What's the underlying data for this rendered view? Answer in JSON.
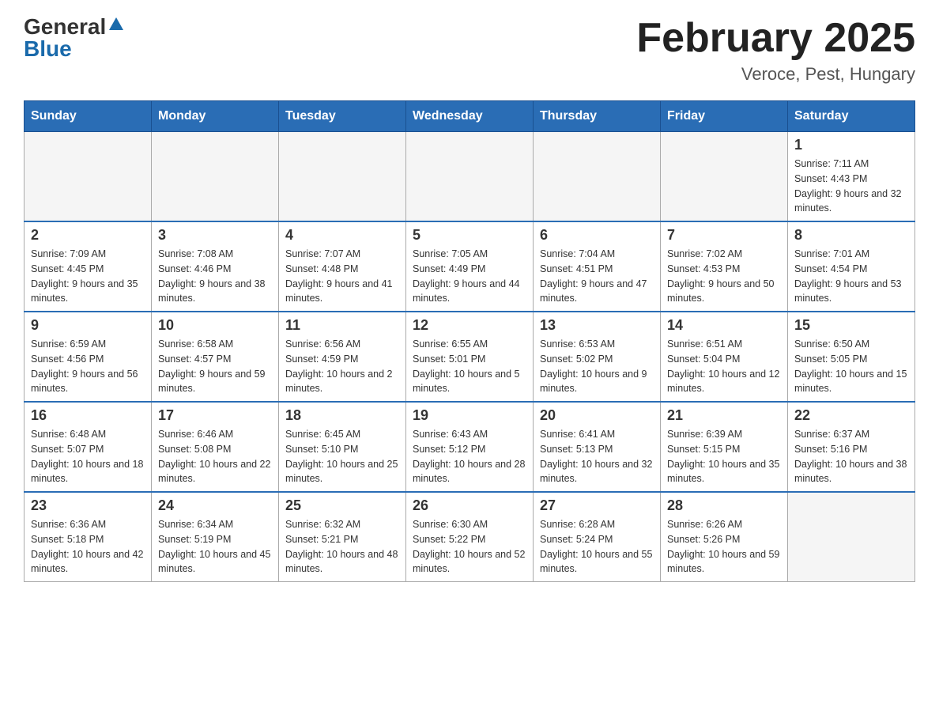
{
  "header": {
    "logo_general": "General",
    "logo_blue": "Blue",
    "month_title": "February 2025",
    "location": "Veroce, Pest, Hungary"
  },
  "days_of_week": [
    "Sunday",
    "Monday",
    "Tuesday",
    "Wednesday",
    "Thursday",
    "Friday",
    "Saturday"
  ],
  "weeks": [
    [
      {
        "day": "",
        "info": ""
      },
      {
        "day": "",
        "info": ""
      },
      {
        "day": "",
        "info": ""
      },
      {
        "day": "",
        "info": ""
      },
      {
        "day": "",
        "info": ""
      },
      {
        "day": "",
        "info": ""
      },
      {
        "day": "1",
        "info": "Sunrise: 7:11 AM\nSunset: 4:43 PM\nDaylight: 9 hours and 32 minutes."
      }
    ],
    [
      {
        "day": "2",
        "info": "Sunrise: 7:09 AM\nSunset: 4:45 PM\nDaylight: 9 hours and 35 minutes."
      },
      {
        "day": "3",
        "info": "Sunrise: 7:08 AM\nSunset: 4:46 PM\nDaylight: 9 hours and 38 minutes."
      },
      {
        "day": "4",
        "info": "Sunrise: 7:07 AM\nSunset: 4:48 PM\nDaylight: 9 hours and 41 minutes."
      },
      {
        "day": "5",
        "info": "Sunrise: 7:05 AM\nSunset: 4:49 PM\nDaylight: 9 hours and 44 minutes."
      },
      {
        "day": "6",
        "info": "Sunrise: 7:04 AM\nSunset: 4:51 PM\nDaylight: 9 hours and 47 minutes."
      },
      {
        "day": "7",
        "info": "Sunrise: 7:02 AM\nSunset: 4:53 PM\nDaylight: 9 hours and 50 minutes."
      },
      {
        "day": "8",
        "info": "Sunrise: 7:01 AM\nSunset: 4:54 PM\nDaylight: 9 hours and 53 minutes."
      }
    ],
    [
      {
        "day": "9",
        "info": "Sunrise: 6:59 AM\nSunset: 4:56 PM\nDaylight: 9 hours and 56 minutes."
      },
      {
        "day": "10",
        "info": "Sunrise: 6:58 AM\nSunset: 4:57 PM\nDaylight: 9 hours and 59 minutes."
      },
      {
        "day": "11",
        "info": "Sunrise: 6:56 AM\nSunset: 4:59 PM\nDaylight: 10 hours and 2 minutes."
      },
      {
        "day": "12",
        "info": "Sunrise: 6:55 AM\nSunset: 5:01 PM\nDaylight: 10 hours and 5 minutes."
      },
      {
        "day": "13",
        "info": "Sunrise: 6:53 AM\nSunset: 5:02 PM\nDaylight: 10 hours and 9 minutes."
      },
      {
        "day": "14",
        "info": "Sunrise: 6:51 AM\nSunset: 5:04 PM\nDaylight: 10 hours and 12 minutes."
      },
      {
        "day": "15",
        "info": "Sunrise: 6:50 AM\nSunset: 5:05 PM\nDaylight: 10 hours and 15 minutes."
      }
    ],
    [
      {
        "day": "16",
        "info": "Sunrise: 6:48 AM\nSunset: 5:07 PM\nDaylight: 10 hours and 18 minutes."
      },
      {
        "day": "17",
        "info": "Sunrise: 6:46 AM\nSunset: 5:08 PM\nDaylight: 10 hours and 22 minutes."
      },
      {
        "day": "18",
        "info": "Sunrise: 6:45 AM\nSunset: 5:10 PM\nDaylight: 10 hours and 25 minutes."
      },
      {
        "day": "19",
        "info": "Sunrise: 6:43 AM\nSunset: 5:12 PM\nDaylight: 10 hours and 28 minutes."
      },
      {
        "day": "20",
        "info": "Sunrise: 6:41 AM\nSunset: 5:13 PM\nDaylight: 10 hours and 32 minutes."
      },
      {
        "day": "21",
        "info": "Sunrise: 6:39 AM\nSunset: 5:15 PM\nDaylight: 10 hours and 35 minutes."
      },
      {
        "day": "22",
        "info": "Sunrise: 6:37 AM\nSunset: 5:16 PM\nDaylight: 10 hours and 38 minutes."
      }
    ],
    [
      {
        "day": "23",
        "info": "Sunrise: 6:36 AM\nSunset: 5:18 PM\nDaylight: 10 hours and 42 minutes."
      },
      {
        "day": "24",
        "info": "Sunrise: 6:34 AM\nSunset: 5:19 PM\nDaylight: 10 hours and 45 minutes."
      },
      {
        "day": "25",
        "info": "Sunrise: 6:32 AM\nSunset: 5:21 PM\nDaylight: 10 hours and 48 minutes."
      },
      {
        "day": "26",
        "info": "Sunrise: 6:30 AM\nSunset: 5:22 PM\nDaylight: 10 hours and 52 minutes."
      },
      {
        "day": "27",
        "info": "Sunrise: 6:28 AM\nSunset: 5:24 PM\nDaylight: 10 hours and 55 minutes."
      },
      {
        "day": "28",
        "info": "Sunrise: 6:26 AM\nSunset: 5:26 PM\nDaylight: 10 hours and 59 minutes."
      },
      {
        "day": "",
        "info": ""
      }
    ]
  ]
}
